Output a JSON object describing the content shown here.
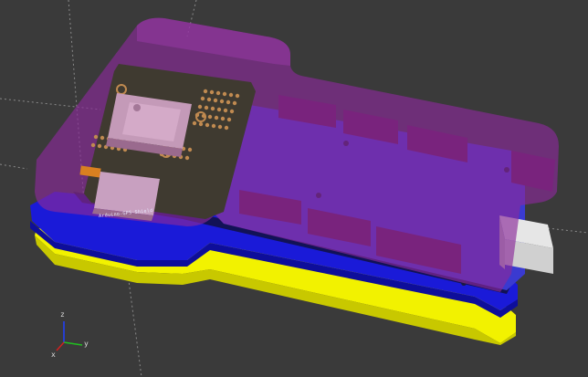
{
  "viewer": {
    "background": "#3a3a3a",
    "board_silkscreen": "Arduino-GPS-Shield",
    "axes": {
      "x": "x",
      "y": "y",
      "z": "z"
    }
  },
  "colors": {
    "yellow_base": "#f2f200",
    "blue_tray": "#1a1ad8",
    "purple_shell": "#8a2a9a",
    "pcb_blue": "#3030c8",
    "gps_module": "#c49ab8",
    "header": "#5a1848",
    "usb": "#e0e0e0"
  },
  "icons": [
    "axes-gizmo-icon"
  ]
}
